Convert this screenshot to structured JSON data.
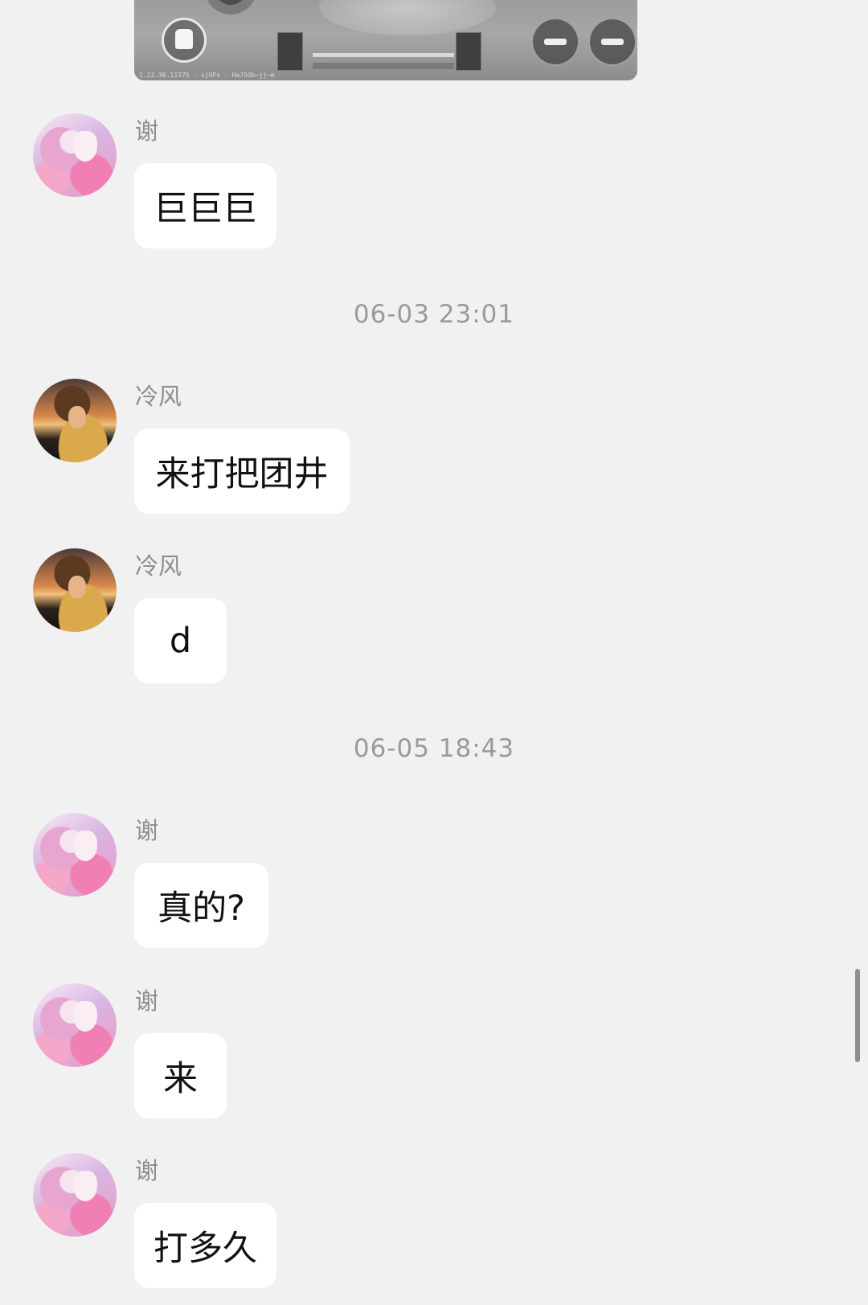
{
  "shared_image": {
    "hud_text": "1.22.36.11375 · sjUFs · HaJ5Ob─jj─m"
  },
  "messages": [
    {
      "sender": "谢",
      "text": "巨巨巨",
      "avatar_icon": "avatar-xie"
    },
    {
      "sender": "冷风",
      "text": "来打把团井",
      "avatar_icon": "avatar-lengfeng"
    },
    {
      "sender": "冷风",
      "text": "d",
      "avatar_icon": "avatar-lengfeng"
    },
    {
      "sender": "谢",
      "text": "真的?",
      "avatar_icon": "avatar-xie"
    },
    {
      "sender": "谢",
      "text": "来",
      "avatar_icon": "avatar-xie"
    },
    {
      "sender": "谢",
      "text": "打多久",
      "avatar_icon": "avatar-xie"
    }
  ],
  "timestamps": [
    "06-03 23:01",
    "06-05 18:43"
  ],
  "colors": {
    "background": "#f1f1f1",
    "bubble": "#ffffff",
    "sender_name": "#8e8e8e",
    "timestamp": "#9a9a9a",
    "message_text": "#111111"
  }
}
